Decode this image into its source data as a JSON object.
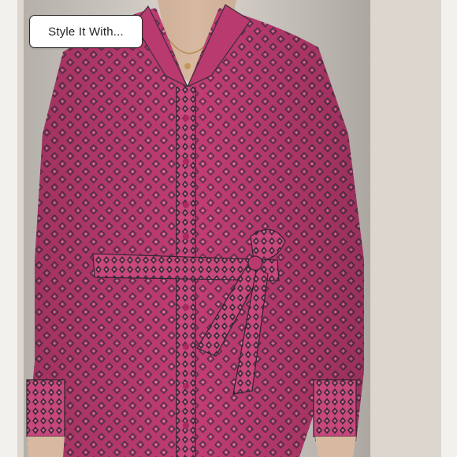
{
  "overlay": {
    "style_button_label": "Style It With..."
  },
  "photo": {
    "subject": "pink geometric print silk shirt dress with tie belt",
    "colors": {
      "fabric": "#c23d74",
      "trim": "#3a2f3a",
      "background": "#dcd6cf",
      "skin": "#d7b8a0"
    }
  }
}
